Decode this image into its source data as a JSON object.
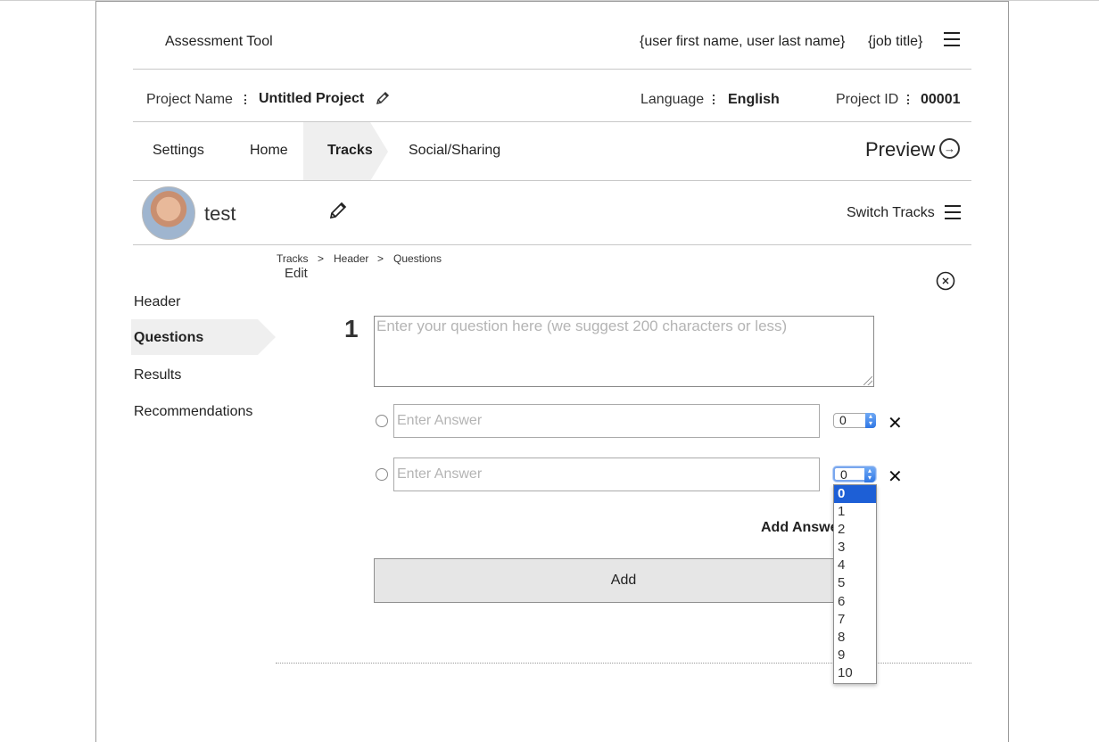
{
  "header": {
    "app_title": "Assessment Tool",
    "user_name": "{user first name, user last name}",
    "job_title": "{job title}",
    "menu_icon": "hamburger-icon"
  },
  "project_bar": {
    "project_name_label": "Project Name",
    "project_name_value": "Untitled Project",
    "edit_icon": "pencil-icon",
    "language_label": "Language",
    "language_value": "English",
    "project_id_label": "Project ID",
    "project_id_value": "00001"
  },
  "tabs": [
    {
      "label": "Settings",
      "active": false
    },
    {
      "label": "Home",
      "active": false
    },
    {
      "label": "Tracks",
      "active": true
    },
    {
      "label": "Social/Sharing",
      "active": false
    }
  ],
  "preview": {
    "label": "Preview",
    "icon": "arrow-right-circle-icon"
  },
  "track": {
    "name": "test",
    "edit_icon": "pencil-icon",
    "switch_label": "Switch Tracks",
    "switch_icon": "hamburger-icon"
  },
  "breadcrumb": {
    "items": [
      "Tracks",
      "Header",
      "Questions"
    ],
    "separator": ">",
    "mode": "Edit"
  },
  "close_icon": "close-circle-icon",
  "subnav": [
    {
      "label": "Header",
      "active": false
    },
    {
      "label": "Questions",
      "active": true
    },
    {
      "label": "Results",
      "active": false
    },
    {
      "label": "Recommendations",
      "active": false
    }
  ],
  "question": {
    "number": "1",
    "placeholder": "Enter your question here (we suggest 200 characters or less)",
    "answers": [
      {
        "placeholder": "Enter Answer",
        "score": "0"
      },
      {
        "placeholder": "Enter Answer",
        "score": "0"
      }
    ],
    "remove_icon": "close-x-icon",
    "add_answer_label": "Add Answe",
    "add_button_label": "Add"
  },
  "score_dropdown": {
    "selected": "0",
    "options": [
      "0",
      "1",
      "2",
      "3",
      "4",
      "5",
      "6",
      "7",
      "8",
      "9",
      "10"
    ]
  },
  "colors": {
    "accent_select": "#1d5fd6",
    "active_tab_bg": "#efefef",
    "button_bg": "#e6e6e6"
  }
}
